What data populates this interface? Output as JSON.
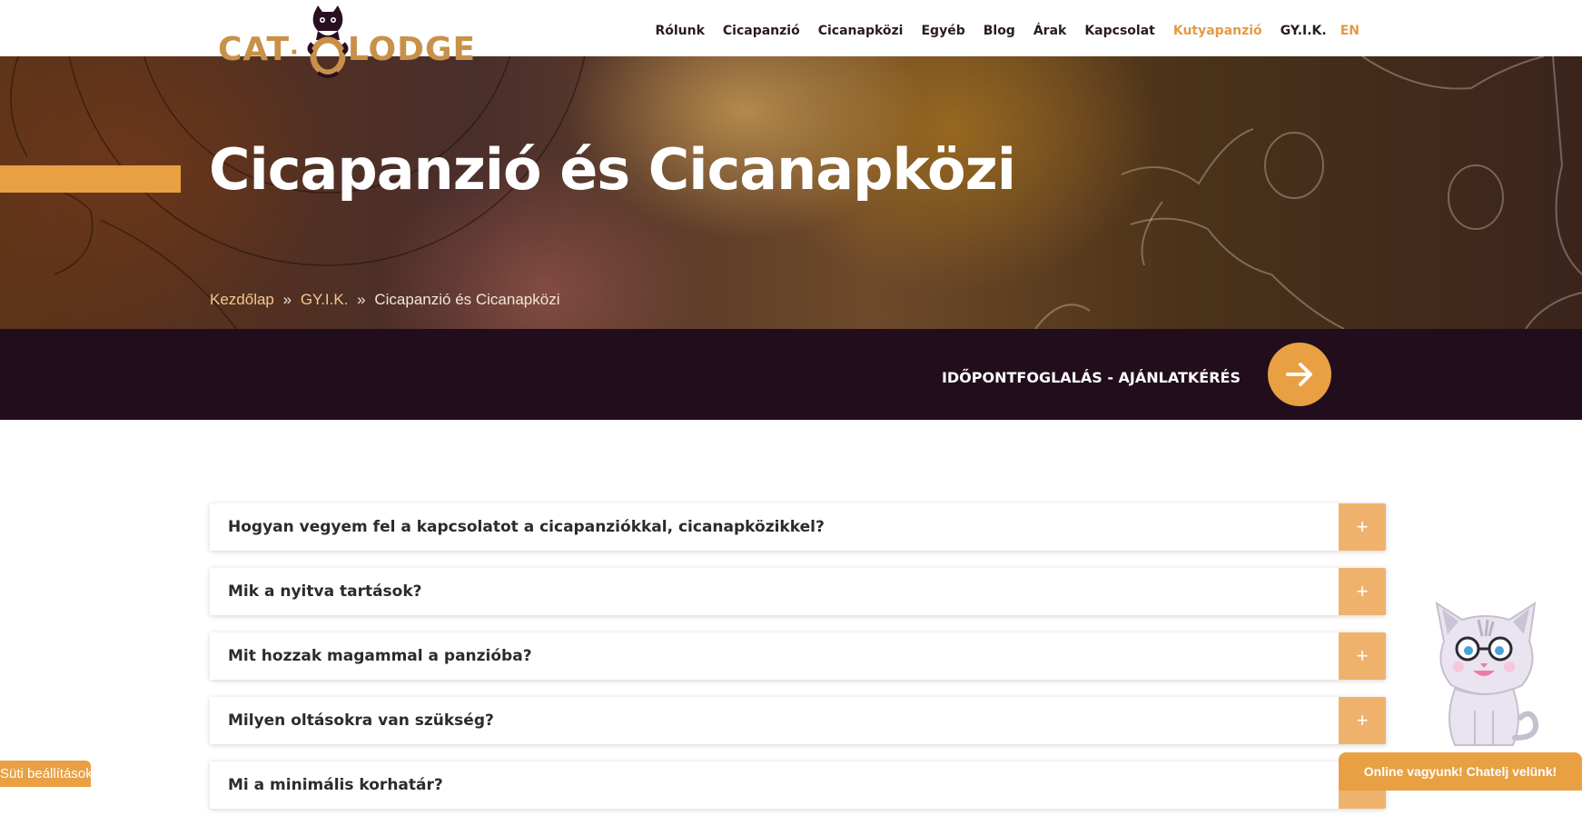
{
  "header": {
    "logo": {
      "left": "CAT",
      "right": "LODGE",
      "icon": "cat-logo-icon",
      "brand_color": "#c8914a"
    },
    "nav": [
      {
        "label": "Rólunk"
      },
      {
        "label": "Cicapanzió"
      },
      {
        "label": "Cicanapközi"
      },
      {
        "label": "Egyéb"
      },
      {
        "label": "Blog"
      },
      {
        "label": "Árak"
      },
      {
        "label": "Kapcsolat"
      },
      {
        "label": "Kutyapanzió",
        "active": true
      },
      {
        "label": "GY.I.K."
      },
      {
        "label": "EN"
      }
    ]
  },
  "hero": {
    "title": "Cicapanzió és Cicanapközi",
    "breadcrumb": {
      "home": "Kezdőlap",
      "sep1": "»",
      "faq": "GY.I.K.",
      "sep2": "»",
      "current": "Cicapanzió és Cicanapközi"
    },
    "accent_color": "#e8a043"
  },
  "booking": {
    "label": "IDŐPONTFOGLALÁS - AJÁNLATKÉRÉS",
    "icon": "arrow-right-icon",
    "background": "#220d1c"
  },
  "faq": {
    "items": [
      {
        "question": "Hogyan vegyem fel a kapcsolatot a cicapanziókkal, cicanapközikkel?",
        "toggle": "+"
      },
      {
        "question": "Mik a nyitva tartások?",
        "toggle": "+"
      },
      {
        "question": "Mit hozzak magammal a panzióba?",
        "toggle": "+"
      },
      {
        "question": "Milyen oltásokra van szükség?",
        "toggle": "+"
      },
      {
        "question": "Mi a minimális korhatár?",
        "toggle": "+"
      }
    ],
    "toggle_color": "#efb26c"
  },
  "cookie": {
    "label": "Süti beállítások"
  },
  "chat": {
    "label": "Online vagyunk! Chatelj velünk!",
    "icon": "cat-mascot-icon"
  }
}
